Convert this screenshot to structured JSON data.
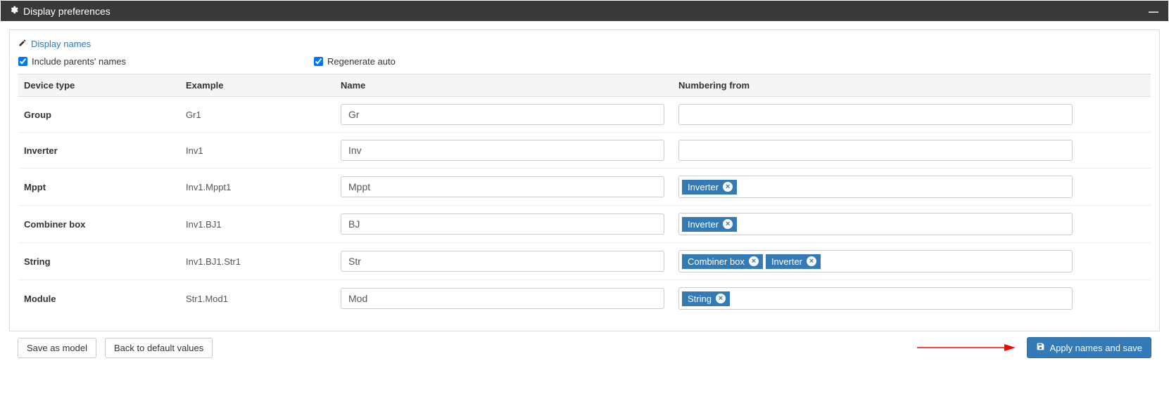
{
  "header": {
    "title": "Display preferences"
  },
  "section": {
    "title": "Display names"
  },
  "checks": {
    "include_parents": {
      "label": "Include parents' names",
      "checked": true
    },
    "regenerate_auto": {
      "label": "Regenerate auto",
      "checked": true
    }
  },
  "columns": {
    "device_type": "Device type",
    "example": "Example",
    "name": "Name",
    "numbering_from": "Numbering from"
  },
  "rows": [
    {
      "type": "Group",
      "example": "Gr1",
      "name": "Gr",
      "tags": []
    },
    {
      "type": "Inverter",
      "example": "Inv1",
      "name": "Inv",
      "tags": []
    },
    {
      "type": "Mppt",
      "example": "Inv1.Mppt1",
      "name": "Mppt",
      "tags": [
        "Inverter"
      ]
    },
    {
      "type": "Combiner box",
      "example": "Inv1.BJ1",
      "name": "BJ",
      "tags": [
        "Inverter"
      ]
    },
    {
      "type": "String",
      "example": "Inv1.BJ1.Str1",
      "name": "Str",
      "tags": [
        "Combiner box",
        "Inverter"
      ]
    },
    {
      "type": "Module",
      "example": "Str1.Mod1",
      "name": "Mod",
      "tags": [
        "String"
      ]
    }
  ],
  "footer": {
    "save_as_model": "Save as model",
    "back_to_defaults": "Back to default values",
    "apply_and_save": "Apply names and save"
  }
}
